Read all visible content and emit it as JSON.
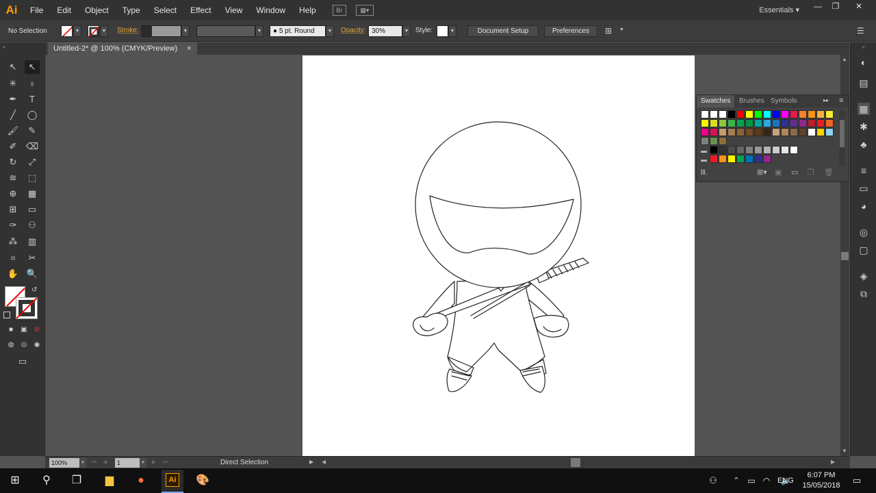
{
  "app": {
    "logo": "Ai",
    "workspace": "Essentials",
    "workspace_arrow": "▾"
  },
  "menu": [
    "File",
    "Edit",
    "Object",
    "Type",
    "Select",
    "Effect",
    "View",
    "Window",
    "Help"
  ],
  "menubar_icons": {
    "bridge": "Br",
    "arrange": "▦▾"
  },
  "window_controls": {
    "minimize": "—",
    "restore": "❐",
    "close": "✕"
  },
  "control": {
    "selection": "No Selection",
    "stroke_label": "Stroke:",
    "brush": "5 pt. Round",
    "opacity_label": "Opacity:",
    "opacity": "30%",
    "style_label": "Style:",
    "document_setup": "Document Setup",
    "preferences": "Preferences",
    "dropdown_arrow": "▼"
  },
  "document": {
    "tab_title": "Untitled-2* @ 100% (CMYK/Preview)",
    "close": "×"
  },
  "swatches_panel": {
    "tabs": [
      "Swatches",
      "Brushes",
      "Symbols"
    ],
    "menu_icon": "≡",
    "expand_icon": "▸▸",
    "libraries_icon": "lll.",
    "rows": [
      [
        "#ffffff",
        "#ffffff",
        "#ffffff",
        "#000000",
        "#ff0000",
        "#ffff00",
        "#00ff00",
        "#00ffff",
        "#0000ff",
        "#ff00ff",
        "#e6194b",
        "#f58231",
        "#f7941d",
        "#fbb040",
        "#f9ed32"
      ],
      [
        "#fff200",
        "#d7df23",
        "#8dc63f",
        "#39b54a",
        "#00a651",
        "#009444",
        "#00a79d",
        "#27aae1",
        "#1c75bc",
        "#2e3192",
        "#662d91",
        "#92278f",
        "#be1e2d",
        "#ed1c24",
        "#f26522"
      ],
      [
        "#ec008c",
        "#d4145a",
        "#c69c6d",
        "#a67c52",
        "#8c6239",
        "#754c24",
        "#603913",
        "#3c2415",
        "#c8a27a",
        "#b0865a",
        "#8a6d4a",
        "#5e4430",
        "#ffffff",
        "#ffd200",
        "#8fd3f4"
      ],
      [
        "#808080",
        "#6a8f4e",
        "#8b6f3b"
      ],
      [
        "#000000",
        "#333333",
        "#4d4d4d",
        "#666666",
        "#808080",
        "#999999",
        "#b3b3b3",
        "#cccccc",
        "#e6e6e6",
        "#ffffff"
      ],
      [
        "#ed1c24",
        "#f7941d",
        "#fff200",
        "#00a651",
        "#0072bc",
        "#2e3192",
        "#92278f"
      ]
    ]
  },
  "status": {
    "zoom": "100%",
    "artboard": "1",
    "tool": "Direct Selection",
    "arrow_right": "▶",
    "arrow_left": "◀",
    "arrow_down": "▼",
    "arrow_up": "▲"
  },
  "taskbar": {
    "time": "6:07 PM",
    "date": "15/05/2018",
    "lang": "ENG"
  },
  "colors": {
    "accent": "#ff9a00",
    "panel": "#323232",
    "canvas": "#535353"
  }
}
